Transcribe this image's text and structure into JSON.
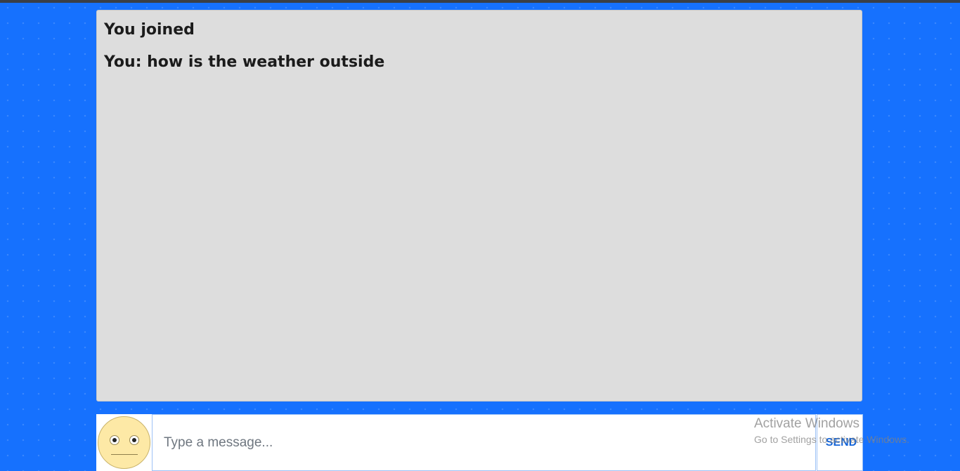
{
  "chat": {
    "messages": [
      {
        "text": "You joined"
      },
      {
        "text": "You: how is the weather outside"
      }
    ]
  },
  "composer": {
    "input_value": "",
    "input_placeholder": "Type a message...",
    "send_label": "SEND",
    "avatar_icon": "neutral-face-icon"
  },
  "watermark": {
    "title": "Activate Windows",
    "subtitle": "Go to Settings to activate Windows."
  },
  "colors": {
    "background": "#1671fe",
    "chat_panel": "#dddddd",
    "send_text": "#1565d8",
    "avatar_face": "#fde9a6"
  }
}
